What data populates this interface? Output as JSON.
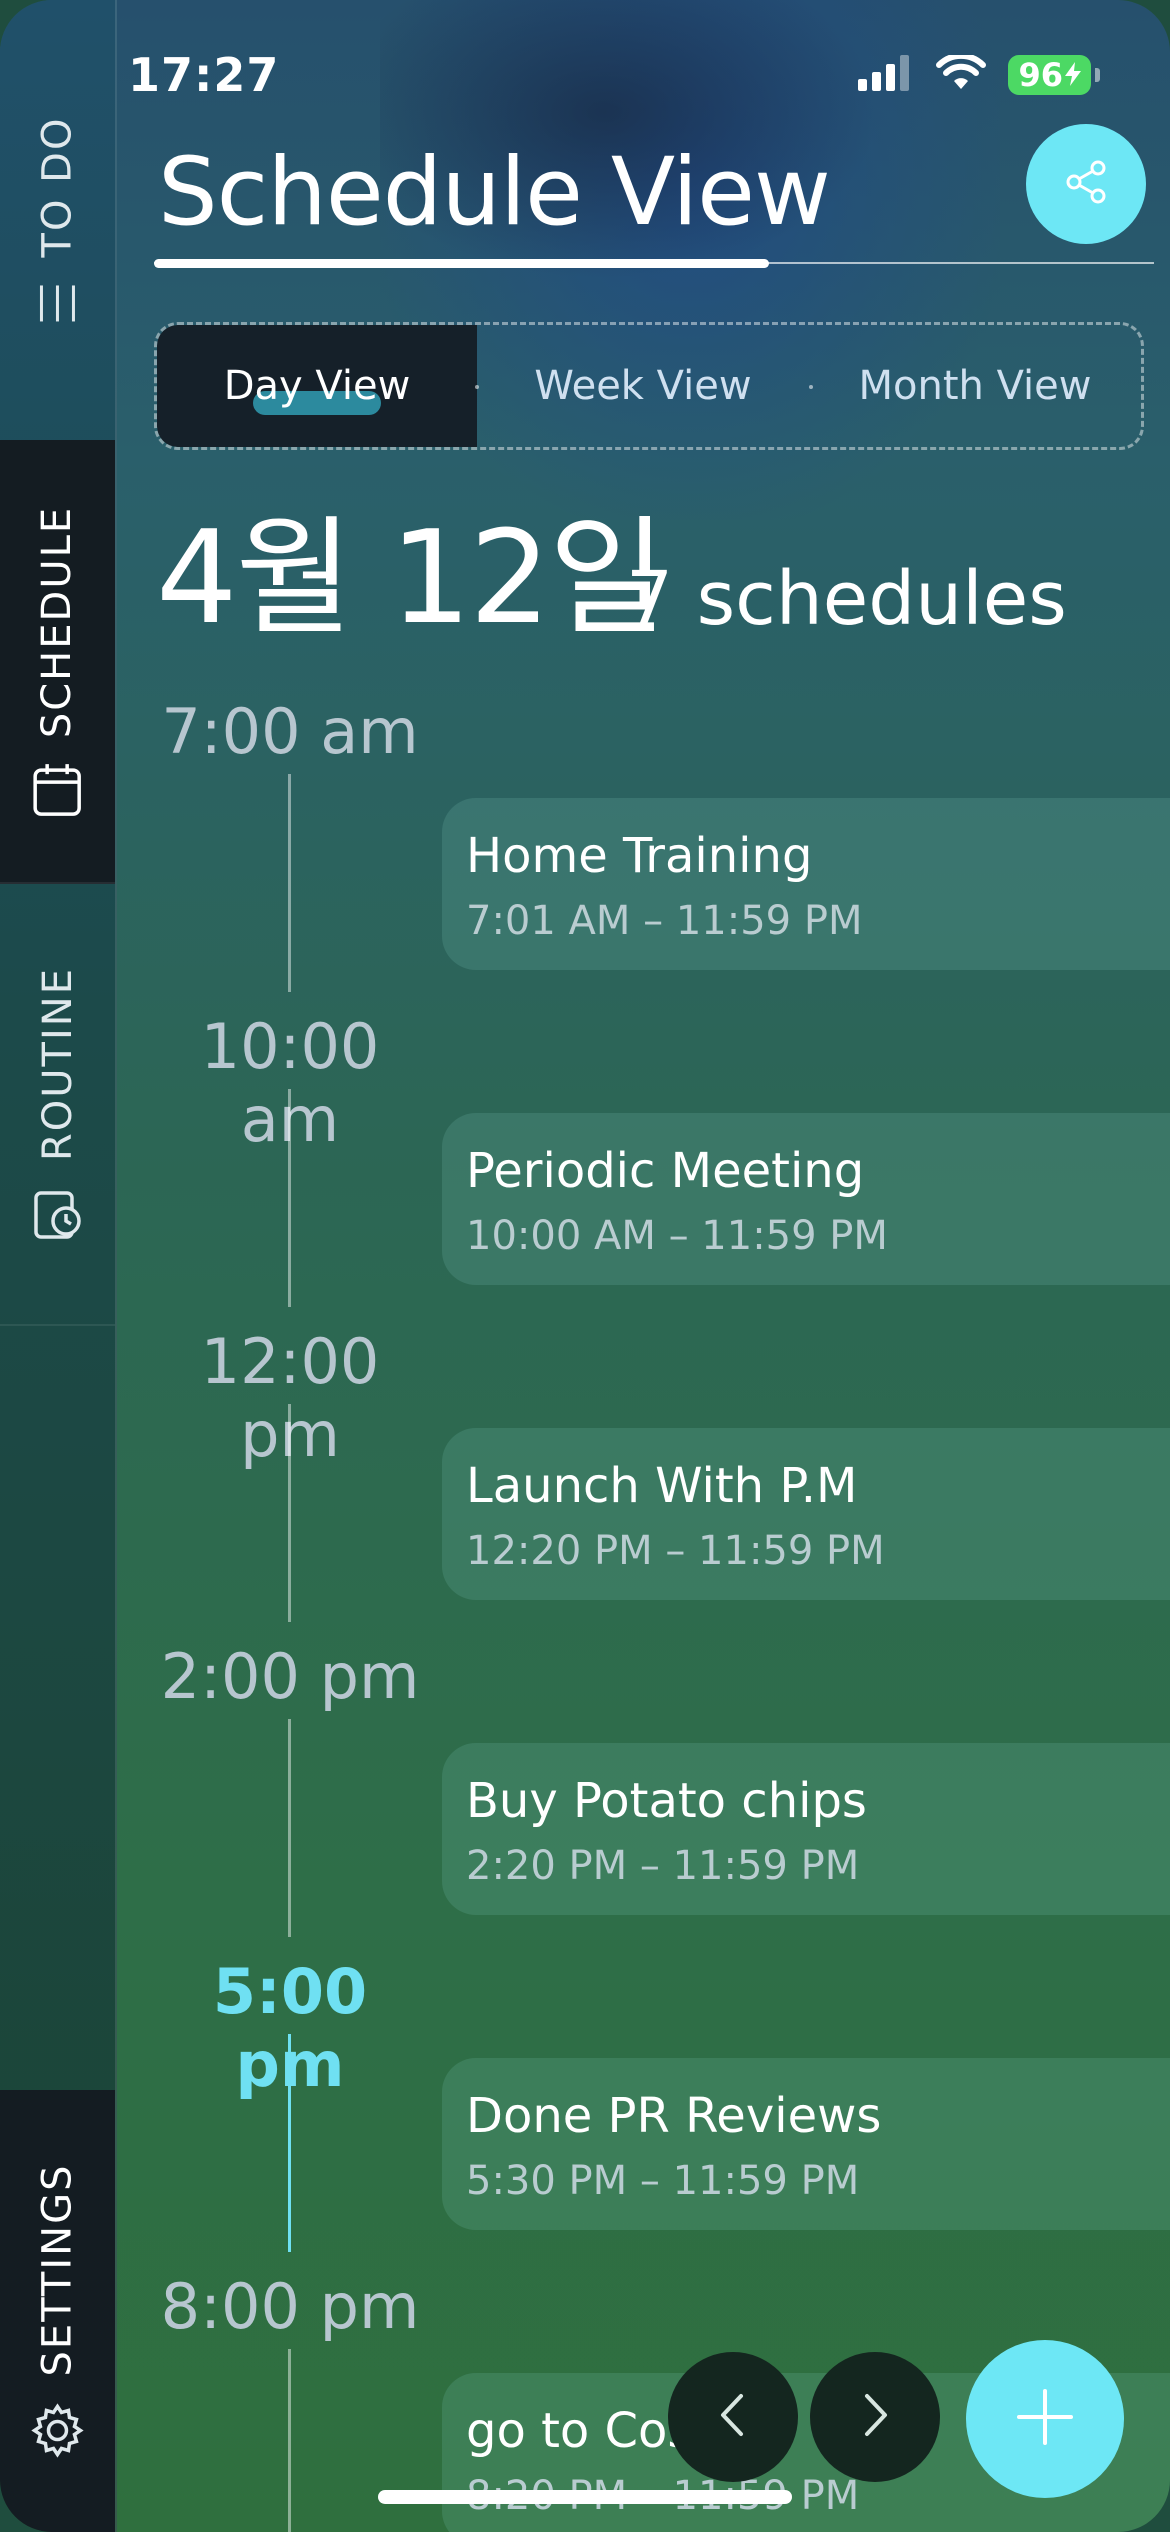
{
  "status_bar": {
    "time": "17:27",
    "battery": "96"
  },
  "sidebar": {
    "items": [
      {
        "label": "TO DO",
        "icon": "list-icon",
        "active": false
      },
      {
        "label": "SCHEDULE",
        "icon": "calendar-icon",
        "active": true
      },
      {
        "label": "ROUTINE",
        "icon": "routine-clock-icon",
        "active": false
      },
      {
        "label": "SETTINGS",
        "icon": "gear-icon",
        "active": false
      }
    ]
  },
  "header": {
    "title": "Schedule View",
    "share_icon": "share-icon"
  },
  "view_tabs": [
    {
      "label": "Day View",
      "active": true
    },
    {
      "label": "Week View",
      "active": false
    },
    {
      "label": "Month View",
      "active": false
    }
  ],
  "date": {
    "label": "4월 12일",
    "count": "7 schedules"
  },
  "timeline": [
    {
      "time": "7:00 am",
      "title": "Home Training",
      "range": "7:01 AM – 11:59 PM",
      "current": false
    },
    {
      "time": "10:00 am",
      "title": " Periodic Meeting",
      "range": "10:00 AM – 11:59 PM",
      "current": false
    },
    {
      "time": "12:00 pm",
      "title": "Launch With P.M",
      "range": "12:20 PM – 11:59 PM",
      "current": false
    },
    {
      "time": "2:00 pm",
      "title": "Buy Potato chips",
      "range": "2:20 PM – 11:59 PM",
      "current": false
    },
    {
      "time": "5:00 pm",
      "title": "Done PR Reviews",
      "range": "5:30 PM – 11:59 PM",
      "current": true
    },
    {
      "time": "8:00 pm",
      "title": "go to Costco",
      "range": "8:20 PM – 11:59 PM",
      "current": false
    }
  ],
  "colors": {
    "accent": "#6de7f5",
    "current_time": "#6fe0f2",
    "active_tab_bg": "#152029"
  },
  "controls": {
    "prev_icon": "chevron-left-icon",
    "next_icon": "chevron-right-icon",
    "add_icon": "plus-icon"
  }
}
